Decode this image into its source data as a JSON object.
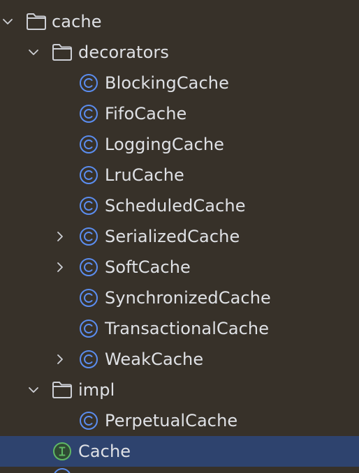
{
  "tree": {
    "rows": [
      {
        "label": "cache",
        "kind": "folder",
        "expander": "expanded"
      },
      {
        "label": "decorators",
        "kind": "folder",
        "expander": "expanded"
      },
      {
        "label": "BlockingCache",
        "kind": "class",
        "expander": "none"
      },
      {
        "label": "FifoCache",
        "kind": "class",
        "expander": "none"
      },
      {
        "label": "LoggingCache",
        "kind": "class",
        "expander": "none"
      },
      {
        "label": "LruCache",
        "kind": "class",
        "expander": "none"
      },
      {
        "label": "ScheduledCache",
        "kind": "class",
        "expander": "none"
      },
      {
        "label": "SerializedCache",
        "kind": "class",
        "expander": "collapsed"
      },
      {
        "label": "SoftCache",
        "kind": "class",
        "expander": "collapsed"
      },
      {
        "label": "SynchronizedCache",
        "kind": "class",
        "expander": "none"
      },
      {
        "label": "TransactionalCache",
        "kind": "class",
        "expander": "none"
      },
      {
        "label": "WeakCache",
        "kind": "class",
        "expander": "collapsed"
      },
      {
        "label": "impl",
        "kind": "folder",
        "expander": "expanded"
      },
      {
        "label": "PerpetualCache",
        "kind": "class",
        "expander": "none"
      },
      {
        "label": "Cache",
        "kind": "interface",
        "expander": "none",
        "selected": true
      }
    ]
  },
  "colors": {
    "background": "#373129",
    "selection": "#2E436E",
    "text": "#DFE1E5",
    "class_icon": "#5B8DEF",
    "interface_icon": "#5FB865",
    "folder_icon": "#CED0D6",
    "chevron": "#CED0D6"
  }
}
